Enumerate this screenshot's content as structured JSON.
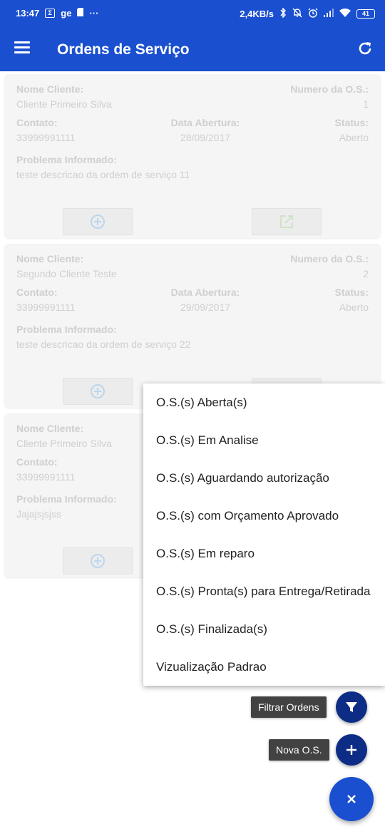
{
  "status_bar": {
    "time": "13:47",
    "network_speed": "2,4KB/s",
    "battery": "41",
    "left_icons": [
      "notification-box-icon",
      "ge-app-icon",
      "sd-card-icon",
      "more-dots-icon"
    ],
    "right_icons": [
      "bluetooth-icon",
      "mute-icon",
      "alarm-icon",
      "signal-icon",
      "wifi-icon",
      "battery-icon"
    ],
    "ge_text": "ge",
    "dots": "···"
  },
  "app_bar": {
    "title": "Ordens de Serviço",
    "color": "#1a4fd0"
  },
  "labels": {
    "nome_cliente": "Nome Cliente:",
    "numero_os": "Numero da O.S.:",
    "contato": "Contato:",
    "data_abertura": "Data Abertura:",
    "status": "Status:",
    "problema": "Problema Informado:"
  },
  "cards": [
    {
      "cliente": "Cliente Primeiro Silva",
      "numero": "1",
      "contato": "33999991111",
      "data_abertura": "28/09/2017",
      "status": "Aberto",
      "problema": "teste descricao da ordem de serviço 11"
    },
    {
      "cliente": "Segundo Cliente Teste",
      "numero": "2",
      "contato": "33999991111",
      "data_abertura": "29/09/2017",
      "status": "Aberto",
      "problema": "teste descricao da ordem de serviço 22"
    },
    {
      "cliente": "Cliente Primeiro Silva",
      "numero": "",
      "contato": "33999991111",
      "data_abertura": "",
      "status": "",
      "problema": "Jajajsjsjss"
    }
  ],
  "filter_menu": {
    "items": [
      "O.S.(s) Aberta(s)",
      "O.S.(s) Em Analise",
      "O.S.(s) Aguardando autorização",
      "O.S.(s) com Orçamento Aprovado",
      "O.S.(s) Em reparo",
      "O.S.(s) Pronta(s) para Entrega/Retirada",
      "O.S.(s) Finalizada(s)",
      "Vizualização Padrao"
    ]
  },
  "fab": {
    "filter_label": "Filtrar Ordens",
    "new_label": "Nova O.S.",
    "close_symbol": "×"
  },
  "colors": {
    "primary": "#1a4fd0",
    "fab_mini": "#0d2c85",
    "card_icon_add": "#bcd6ee",
    "card_icon_open": "#cfe3c8"
  }
}
